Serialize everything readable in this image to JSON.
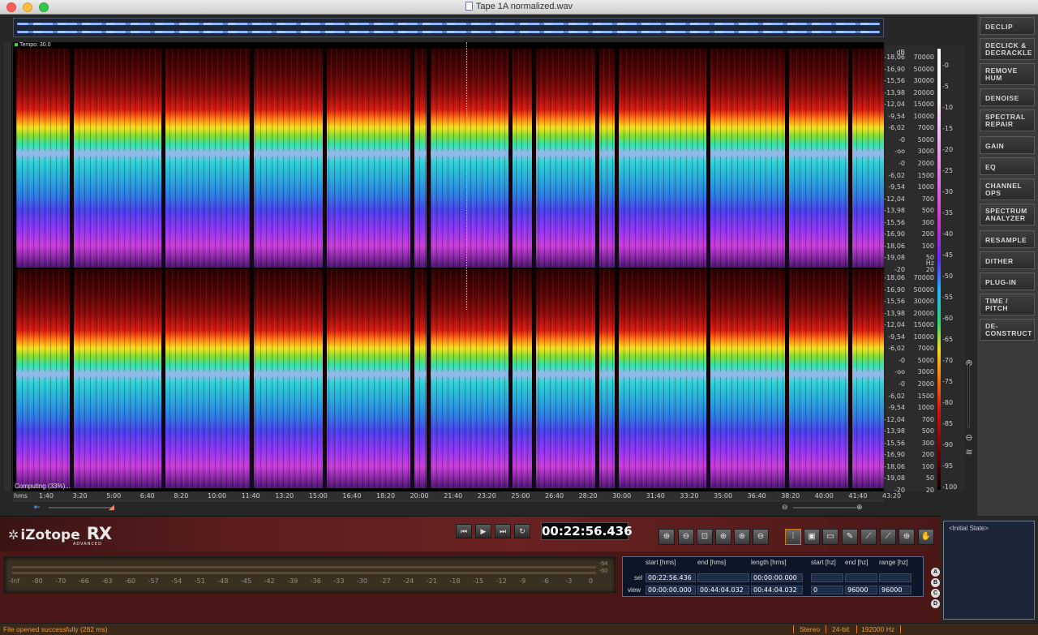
{
  "window": {
    "title": "Tape 1A normalized.wav"
  },
  "spectrogram": {
    "tempo_label": "Tempo: 30.0",
    "computing_label": "Computing (33%)...",
    "db_unit": "dB",
    "hz_unit": "Hz",
    "db_ticks_ch1": [
      "-18,06",
      "-16,90",
      "-15,56",
      "-13,98",
      "-12,04",
      "-9,54",
      "-6,02",
      "-0",
      "-oo",
      "-0",
      "-6,02",
      "-9,54",
      "-12,04",
      "-13,98",
      "-15,56",
      "-16,90",
      "-18,06",
      "-19,08",
      "-20"
    ],
    "hz_ticks_ch1": [
      "70000",
      "50000",
      "30000",
      "20000",
      "15000",
      "10000",
      "7000",
      "5000",
      "3000",
      "2000",
      "1500",
      "1000",
      "700",
      "500",
      "300",
      "200",
      "100",
      "50",
      "20"
    ],
    "db_ticks_ch2": [
      "-18,06",
      "-16,90",
      "-15,56",
      "-13,98",
      "-12,04",
      "-9,54",
      "-6,02",
      "-0",
      "-oo",
      "-0",
      "-6,02",
      "-9,54",
      "-12,04",
      "-13,98",
      "-15,56",
      "-16,90",
      "-18,06",
      "-19,08",
      "-20"
    ],
    "hz_ticks_ch2": [
      "70000",
      "50000",
      "30000",
      "20000",
      "15000",
      "10000",
      "7000",
      "5000",
      "3000",
      "2000",
      "1500",
      "1000",
      "700",
      "500",
      "300",
      "200",
      "100",
      "50",
      "20"
    ],
    "color_scale": [
      "-0",
      "-5",
      "-10",
      "-15",
      "-20",
      "-25",
      "-30",
      "-35",
      "-40",
      "-45",
      "-50",
      "-55",
      "-60",
      "-65",
      "-70",
      "-75",
      "-80",
      "-85",
      "-90",
      "-95",
      "-100"
    ]
  },
  "time_ruler": {
    "unit": "hms",
    "labels": [
      "1:40",
      "3:20",
      "5:00",
      "6:40",
      "8:20",
      "10:00",
      "11:40",
      "13:20",
      "15:00",
      "16:40",
      "18:20",
      "20:00",
      "21:40",
      "23:20",
      "25:00",
      "26:40",
      "28:20",
      "30:00",
      "31:40",
      "33:20",
      "35:00",
      "36:40",
      "38:20",
      "40:00",
      "41:40",
      "43:20"
    ]
  },
  "modules": [
    {
      "label": "DECLIP",
      "lines": 1,
      "gapped": false
    },
    {
      "label": "DECLICK & DECRACKLE",
      "lines": 2,
      "gapped": false
    },
    {
      "label": "REMOVE HUM",
      "lines": 2,
      "gapped": false
    },
    {
      "label": "DENOISE",
      "lines": 1,
      "gapped": false
    },
    {
      "label": "SPECTRAL REPAIR",
      "lines": 2,
      "gapped": false
    },
    {
      "label": "GAIN",
      "lines": 1,
      "gapped": true
    },
    {
      "label": "EQ",
      "lines": 1,
      "gapped": false
    },
    {
      "label": "CHANNEL OPS",
      "lines": 2,
      "gapped": false
    },
    {
      "label": "SPECTRUM ANALYZER",
      "lines": 2,
      "gapped": false
    },
    {
      "label": "RESAMPLE",
      "lines": 1,
      "gapped": true
    },
    {
      "label": "DITHER",
      "lines": 1,
      "gapped": false
    },
    {
      "label": "PLUG-IN",
      "lines": 1,
      "gapped": false
    },
    {
      "label": "TIME / PITCH",
      "lines": 2,
      "gapped": false
    },
    {
      "label": "DE-CONSTRUCT",
      "lines": 2,
      "gapped": false
    }
  ],
  "transport": {
    "logo_brand": "iZotope",
    "logo_product": "RX",
    "logo_edition": "ADVANCED",
    "timecode": "00:22:56.436"
  },
  "meter": {
    "scale": [
      "-Inf",
      "-80",
      "-70",
      "-66",
      "-63",
      "-60",
      "-57",
      "-54",
      "-51",
      "-48",
      "-45",
      "-42",
      "-39",
      "-36",
      "-33",
      "-30",
      "-27",
      "-24",
      "-21",
      "-18",
      "-15",
      "-12",
      "-9",
      "-6",
      "-3",
      "0"
    ],
    "side_top": "-54",
    "side_bottom": "-60"
  },
  "selection": {
    "headers": {
      "start_hms": "start [hms]",
      "end_hms": "end [hms]",
      "length_hms": "length [hms]",
      "start_hz": "start [hz]",
      "end_hz": "end [hz]",
      "range_hz": "range [hz]"
    },
    "sel_label": "sel",
    "view_label": "view",
    "sel": {
      "start": "00:22:56.436",
      "end": "",
      "length": "00:00:00.000",
      "start_hz": "",
      "end_hz": "",
      "range_hz": ""
    },
    "view": {
      "start": "00:00:00.000",
      "end": "00:44:04.032",
      "length": "00:44:04.032",
      "start_hz": "0",
      "end_hz": "96000",
      "range_hz": "96000"
    }
  },
  "abcd": [
    "A",
    "B",
    "C",
    "D"
  ],
  "history": {
    "items": [
      "<Initial State>"
    ]
  },
  "status": {
    "message": "File opened successfully (282 ms)",
    "channels": "Stereo",
    "bit_depth": "24-bit",
    "sample_rate": "192000 Hz"
  }
}
